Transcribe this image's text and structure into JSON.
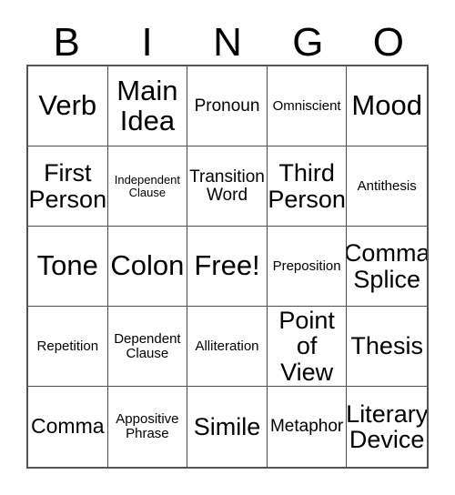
{
  "card": {
    "title": "BINGO",
    "header_letters": [
      "B",
      "I",
      "N",
      "G",
      "O"
    ],
    "colors": {
      "background": "#ffffff",
      "text": "#000000",
      "outer_border": "#555555",
      "inner_border": "#4d4d4d"
    },
    "grid": {
      "columns": 5,
      "rows": 5,
      "cells": [
        {
          "label": "Verb",
          "size": "fs-xxl"
        },
        {
          "label": "Main Idea",
          "size": "fs-xxl"
        },
        {
          "label": "Pronoun",
          "size": "fs-md"
        },
        {
          "label": "Omniscient",
          "size": "fs-sm"
        },
        {
          "label": "Mood",
          "size": "fs-xxl"
        },
        {
          "label": "First Person",
          "size": "fs-xl"
        },
        {
          "label": "Independent Clause",
          "size": "fs-xs"
        },
        {
          "label": "Transition Word",
          "size": "fs-md"
        },
        {
          "label": "Third Person",
          "size": "fs-xl"
        },
        {
          "label": "Antithesis",
          "size": "fs-sm"
        },
        {
          "label": "Tone",
          "size": "fs-xxl"
        },
        {
          "label": "Colon",
          "size": "fs-xxl"
        },
        {
          "label": "Free!",
          "size": "fs-xxl"
        },
        {
          "label": "Preposition",
          "size": "fs-sm"
        },
        {
          "label": "Comma Splice",
          "size": "fs-xl"
        },
        {
          "label": "Repetition",
          "size": "fs-sm"
        },
        {
          "label": "Dependent Clause",
          "size": "fs-sm"
        },
        {
          "label": "Alliteration",
          "size": "fs-sm"
        },
        {
          "label": "Point of View",
          "size": "fs-xl"
        },
        {
          "label": "Thesis",
          "size": "fs-xl"
        },
        {
          "label": "Comma",
          "size": "fs-lg"
        },
        {
          "label": "Appositive Phrase",
          "size": "fs-sm"
        },
        {
          "label": "Simile",
          "size": "fs-xl"
        },
        {
          "label": "Metaphor",
          "size": "fs-md"
        },
        {
          "label": "Literary Device",
          "size": "fs-xl"
        }
      ]
    }
  }
}
